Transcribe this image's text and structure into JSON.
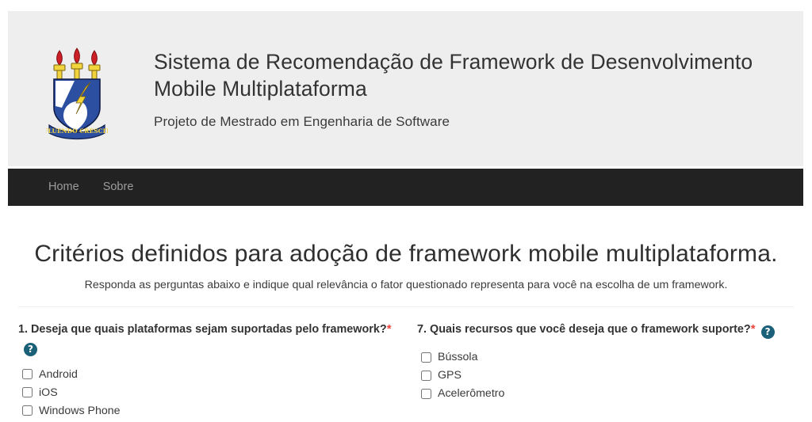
{
  "header": {
    "logo_alt": "Brasão da Universidade Federal de Sergipe",
    "logo_motto": "FLUENDO CRESCIT",
    "title": "Sistema de Recomendação de Framework de Desenvolvimento Mobile Multiplataforma",
    "subtitle": "Projeto de Mestrado em Engenharia de Software"
  },
  "navbar": {
    "items": [
      {
        "label": "Home"
      },
      {
        "label": "Sobre"
      }
    ]
  },
  "main": {
    "heading": "Critérios definidos para adoção de framework mobile multiplataforma.",
    "lead": "Responda as perguntas abaixo e indique qual relevância o fator questionado representa para você na escolha de um framework.",
    "required_marker": "*",
    "help_glyph": "?",
    "questions": [
      {
        "number": "1.",
        "text": "Deseja que quais plataformas sejam suportadas pelo framework?",
        "required": true,
        "options": [
          {
            "label": "Android",
            "checked": false
          },
          {
            "label": "iOS",
            "checked": false
          },
          {
            "label": "Windows Phone",
            "checked": false
          }
        ]
      },
      {
        "number": "7.",
        "text": "Quais recursos que você deseja que o framework suporte?",
        "required": true,
        "options": [
          {
            "label": "Bússola",
            "checked": false
          },
          {
            "label": "GPS",
            "checked": false
          },
          {
            "label": "Acelerômetro",
            "checked": false
          }
        ]
      }
    ]
  },
  "colors": {
    "header_bg": "#eeeeee",
    "navbar_bg": "#222222",
    "nav_link": "#9d9d9d",
    "help_icon_bg": "#1b6079",
    "required_star": "#e8453c",
    "text": "#333333"
  }
}
